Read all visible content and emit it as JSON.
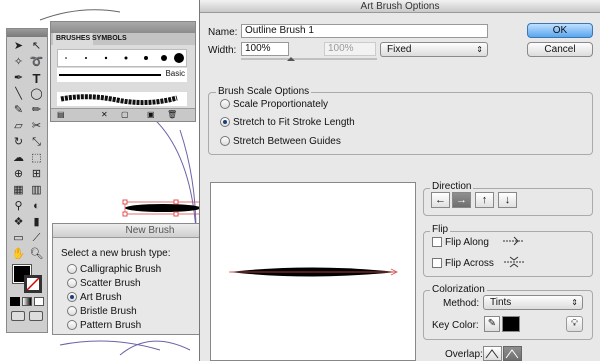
{
  "art_brush_options": {
    "title": "Art Brush Options",
    "name_label": "Name:",
    "name_value": "Outline Brush 1",
    "width_label": "Width:",
    "width_value": "100%",
    "width_secondary": "100%",
    "width_mode": "Fixed",
    "ok_label": "OK",
    "cancel_label": "Cancel",
    "scale_group_title": "Brush Scale Options",
    "scale_options": [
      {
        "label": "Scale Proportionately",
        "selected": false
      },
      {
        "label": "Stretch to Fit Stroke Length",
        "selected": true
      },
      {
        "label": "Stretch Between Guides",
        "selected": false
      }
    ],
    "direction_title": "Direction",
    "direction_buttons": [
      {
        "icon": "arrow-left",
        "glyph": "←",
        "selected": false
      },
      {
        "icon": "arrow-right",
        "glyph": "→",
        "selected": true
      },
      {
        "icon": "arrow-up",
        "glyph": "↑",
        "selected": false
      },
      {
        "icon": "arrow-down",
        "glyph": "↓",
        "selected": false
      }
    ],
    "flip_title": "Flip",
    "flip_along_label": "Flip Along",
    "flip_across_label": "Flip Across",
    "colorization_title": "Colorization",
    "method_label": "Method:",
    "method_value": "Tints",
    "key_color_label": "Key Color:",
    "key_color": "#000000",
    "overlap_label": "Overlap:"
  },
  "new_brush_dialog": {
    "title": "New Brush",
    "prompt": "Select a new brush type:",
    "options": [
      {
        "label": "Calligraphic Brush",
        "selected": false
      },
      {
        "label": "Scatter Brush",
        "selected": false
      },
      {
        "label": "Art Brush",
        "selected": true
      },
      {
        "label": "Bristle Brush",
        "selected": false
      },
      {
        "label": "Pattern Brush",
        "selected": false
      }
    ]
  },
  "brushes_panel": {
    "tabs": [
      "BRUSHES",
      "SYMBOLS"
    ],
    "basic_label": "Basic"
  },
  "tools_panel": {
    "tools": [
      "selection",
      "direct-selection",
      "magic-wand",
      "lasso",
      "pen",
      "type",
      "line",
      "rectangle",
      "paintbrush",
      "pencil",
      "eraser",
      "rotate",
      "scale",
      "warp",
      "free-transform",
      "shape-builder",
      "perspective",
      "mesh",
      "gradient",
      "eyedropper",
      "blend",
      "symbol-sprayer",
      "column-graph",
      "artboard",
      "slice",
      "hand",
      "zoom"
    ]
  },
  "colors": {
    "accent": "#5aa6ee",
    "stroke_guide": "#e05050"
  }
}
